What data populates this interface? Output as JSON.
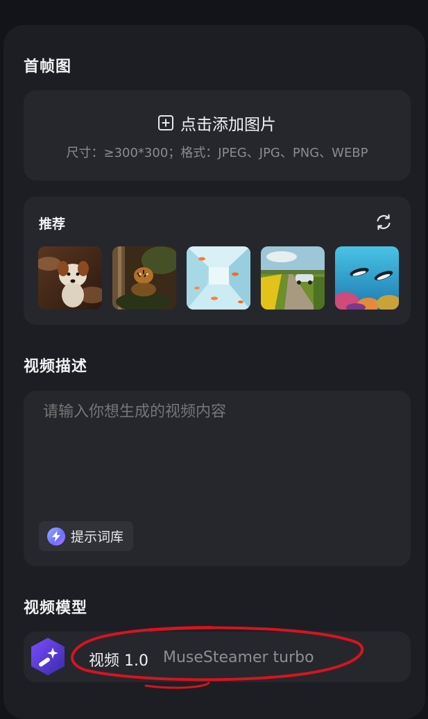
{
  "first_frame": {
    "title": "首帧图",
    "upload_label": "点击添加图片",
    "upload_hint": "尺寸：≥300*300；格式：JPEG、JPG、PNG、WEBP"
  },
  "recommend": {
    "title": "推荐",
    "refresh_icon": "refresh-icon",
    "thumbnails": [
      {
        "subject": "dog"
      },
      {
        "subject": "tiger-cub"
      },
      {
        "subject": "goldfish-corridor"
      },
      {
        "subject": "country-road-car"
      },
      {
        "subject": "underwater-penguins"
      }
    ]
  },
  "description": {
    "title": "视频描述",
    "placeholder": "请输入你想生成的视频内容",
    "prompt_library_label": "提示词库"
  },
  "model": {
    "title": "视频模型",
    "name": "视频 1.0",
    "engine": "MuseSteamer turbo"
  },
  "colors": {
    "background": "#131419",
    "panel": "#1d1e23",
    "card": "#26272d",
    "annotation": "#d6141f"
  }
}
